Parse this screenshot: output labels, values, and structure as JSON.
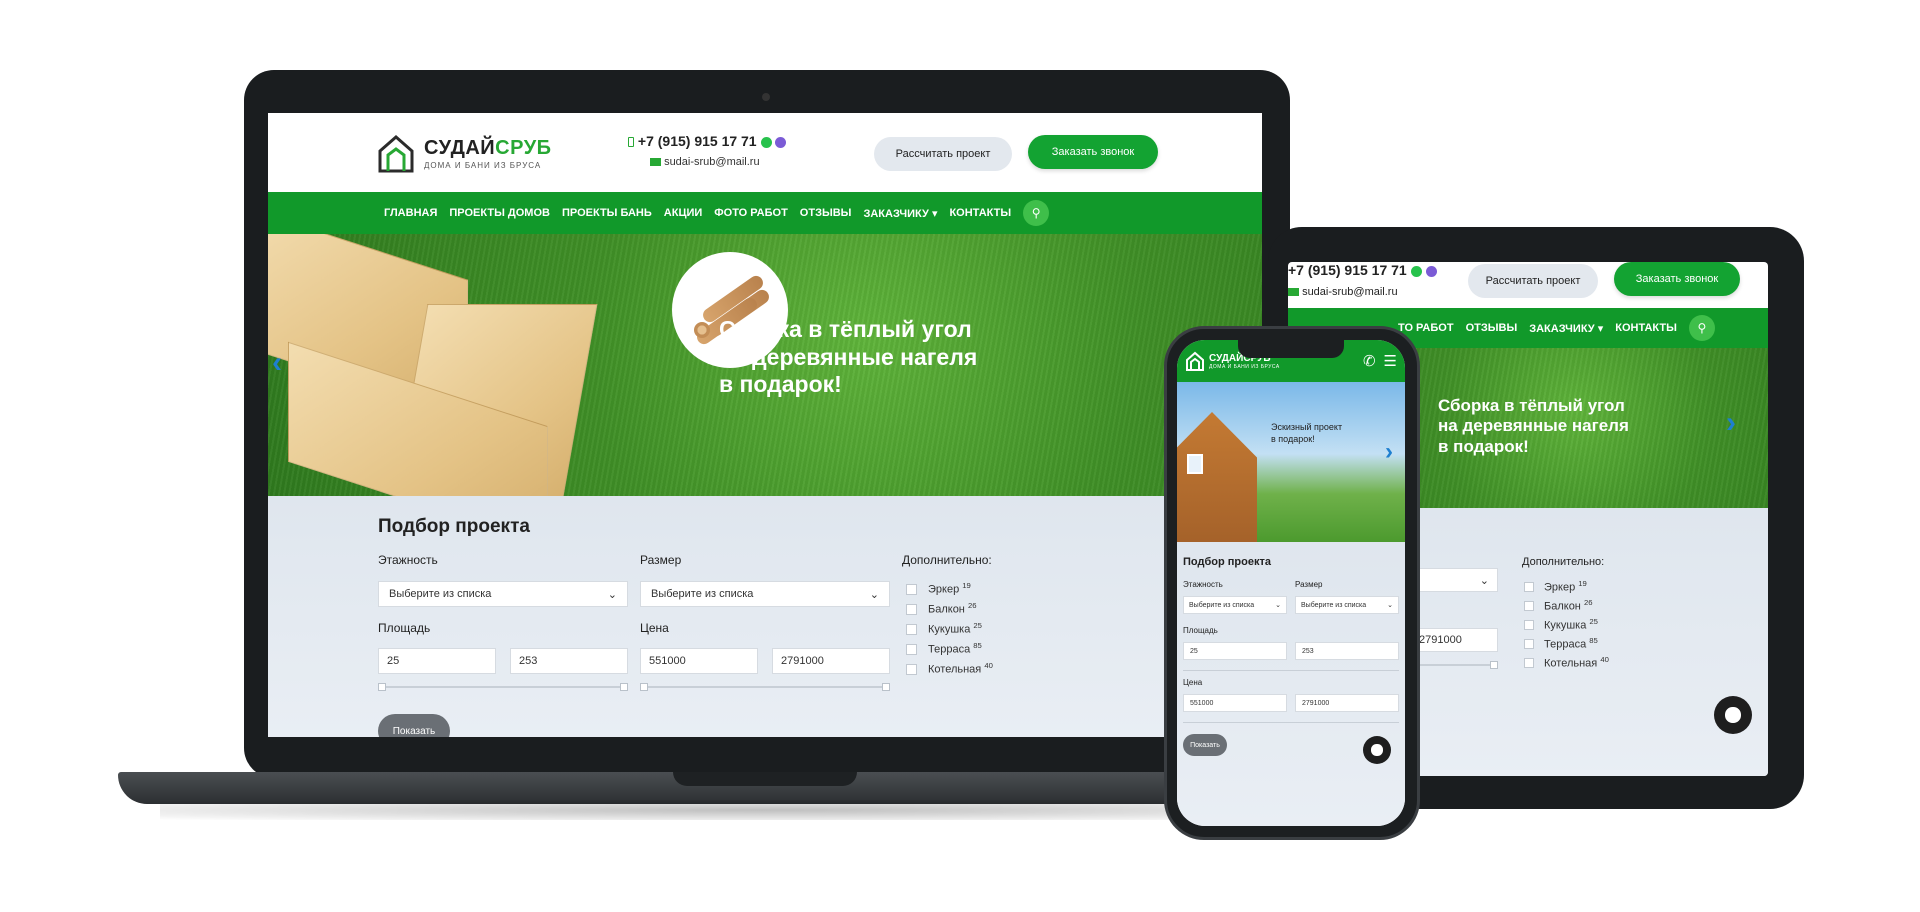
{
  "brand": {
    "name_part1": "СУДАЙ",
    "name_part2": "СРУБ",
    "tagline": "ДОМА И БАНИ ИЗ БРУСА",
    "accent_color": "#11992a"
  },
  "contacts": {
    "phone": "+7 (915) 915 17 71",
    "email": "sudai-srub@mail.ru"
  },
  "header_buttons": {
    "calc": "Рассчитать проект",
    "call": "Заказать звонок"
  },
  "nav": {
    "items": [
      "ГЛАВНАЯ",
      "ПРОЕКТЫ ДОМОВ",
      "ПРОЕКТЫ БАНЬ",
      "АКЦИИ",
      "ФОТО РАБОТ",
      "ОТЗЫВЫ",
      "ЗАКАЗЧИКУ ▾",
      "КОНТАКТЫ"
    ],
    "tablet_items": [
      "ТО РАБОТ",
      "ОТЗЫВЫ",
      "ЗАКАЗЧИКУ ▾",
      "КОНТАКТЫ"
    ]
  },
  "hero": {
    "line1": "Сборка в тёплый угол",
    "line2": "на деревянные нагеля",
    "line3": "в подарок!",
    "phone_line1": "Эскизный проект",
    "phone_line2": "в подарок!"
  },
  "filter": {
    "title": "Подбор проекта",
    "floors_label": "Этажность",
    "size_label": "Размер",
    "select_placeholder": "Выберите из списка",
    "area_label": "Площадь",
    "area_min": "25",
    "area_max": "253",
    "price_label": "Цена",
    "price_min": "551000",
    "price_max": "2791000",
    "extra_label": "Дополнительно:",
    "extras": [
      {
        "name": "Эркер",
        "count": "19"
      },
      {
        "name": "Балкон",
        "count": "26"
      },
      {
        "name": "Кукушка",
        "count": "25"
      },
      {
        "name": "Терраса",
        "count": "85"
      },
      {
        "name": "Котельная",
        "count": "40"
      }
    ],
    "show_button": "Показать"
  },
  "icons": {
    "search": "search-icon",
    "phone": "phone-icon",
    "mail": "mail-icon",
    "whatsapp": "whatsapp-icon",
    "viber": "viber-icon",
    "chat": "chat-icon",
    "menu": "hamburger-icon"
  }
}
